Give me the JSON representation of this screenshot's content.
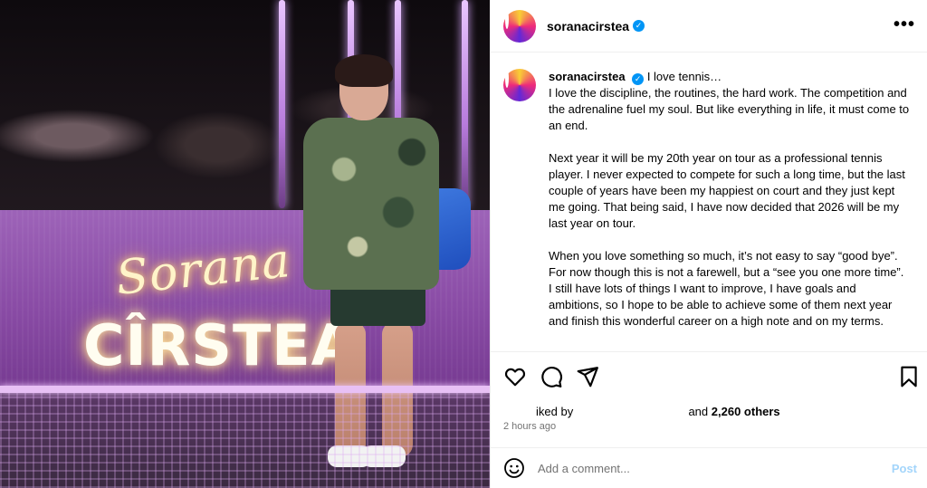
{
  "photo": {
    "sign_script": "Sorana",
    "sign_main": "CÎRSTEA"
  },
  "header": {
    "username": "soranacirstea",
    "verified_badge": "✓",
    "more_icon": "more-options-icon",
    "more_label": "•••"
  },
  "caption": {
    "username": "soranacirstea",
    "lead": "I love tennis…",
    "paragraphs": [
      "I love the discipline, the routines, the hard work. The competition and the adrenaline fuel my soul. But like everything in life, it must come to an end.",
      "Next year it will be my 20th year on tour as a professional tennis player. I never expected to compete for such a long time, but the last couple of years have been my happiest on court and they just kept me going. That being said, I have now decided that 2026 will be my last year on tour.",
      "When you love something so much, it’s not easy to say “good bye”. For now though this is not a farewell, but a “see you one more time”.",
      "I still have lots of things I want to improve, I have goals and ambitions, so I hope to be able to achieve some of them next year and finish this wonderful career on a high note and on my terms."
    ]
  },
  "actions": {
    "like_icon": "heart-icon",
    "comment_icon": "comment-icon",
    "share_icon": "share-icon",
    "save_icon": "bookmark-icon"
  },
  "likes": {
    "liked_by": "iked by",
    "and": "and",
    "others": "2,260 others"
  },
  "timestamp": "2 hours ago",
  "comment": {
    "emoji_icon": "emoji-icon",
    "placeholder": "Add a comment...",
    "post_label": "Post"
  },
  "colors": {
    "verified": "#0095f6",
    "post_disabled": "#a3d5fb",
    "muted": "#737373"
  }
}
